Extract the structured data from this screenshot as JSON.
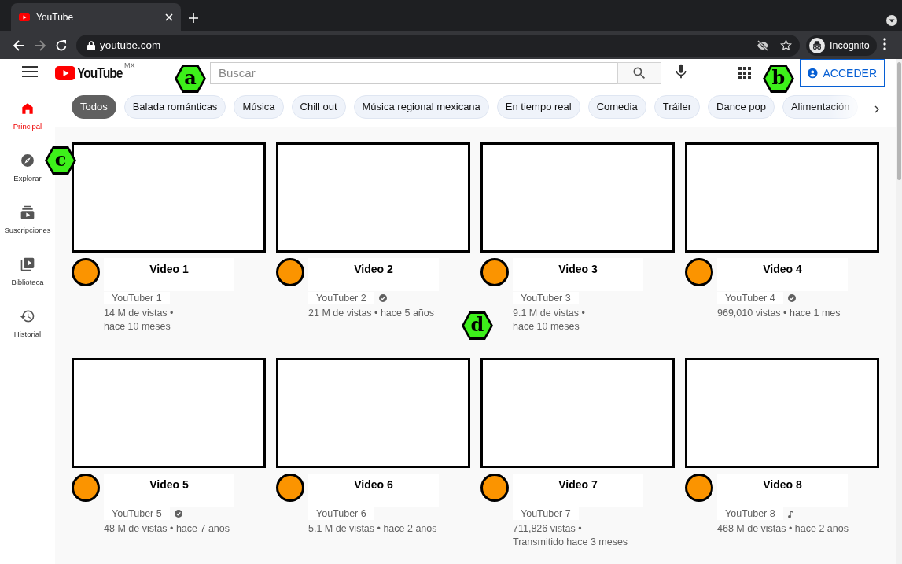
{
  "browser": {
    "tab_title": "YouTube",
    "url": "youtube.com",
    "profile": "Incógnito"
  },
  "header": {
    "logo_text": "YouTube",
    "region": "MX",
    "search": {
      "placeholder": "Buscar"
    },
    "sign_in": "ACCEDER"
  },
  "chips": [
    {
      "label": "Todos",
      "selected": true
    },
    {
      "label": "Balada románticas",
      "selected": false
    },
    {
      "label": "Música",
      "selected": false
    },
    {
      "label": "Chill out",
      "selected": false
    },
    {
      "label": "Música regional mexicana",
      "selected": false
    },
    {
      "label": "En tiempo real",
      "selected": false
    },
    {
      "label": "Comedia",
      "selected": false
    },
    {
      "label": "Tráiler",
      "selected": false
    },
    {
      "label": "Dance pop",
      "selected": false
    },
    {
      "label": "Alimentación",
      "selected": false
    }
  ],
  "sidebar": {
    "items": [
      {
        "label": "Principal",
        "selected": true
      },
      {
        "label": "Explorar",
        "selected": false
      },
      {
        "label": "Suscripciones",
        "selected": false
      },
      {
        "label": "Biblioteca",
        "selected": false
      },
      {
        "label": "Historial",
        "selected": false
      }
    ]
  },
  "videos": [
    {
      "title": "Video 1",
      "channel": "YouTuber 1",
      "kind": "plain",
      "meta": [
        "14 M de vistas •",
        "hace 10 meses"
      ]
    },
    {
      "title": "Video 2",
      "channel": "YouTuber 2",
      "kind": "verified",
      "meta": [
        "21 M de vistas • hace 5 años"
      ]
    },
    {
      "title": "Video 3",
      "channel": "YouTuber 3",
      "kind": "plain",
      "meta": [
        "9.1 M de vistas •",
        "hace 10 meses"
      ]
    },
    {
      "title": "Video 4",
      "channel": "YouTuber 4",
      "kind": "verified",
      "meta": [
        "969,010 vistas • hace 1 mes"
      ]
    },
    {
      "title": "Video 5",
      "channel": "YouTuber 5",
      "kind": "verified",
      "meta": [
        "48 M de vistas • hace 7 años"
      ]
    },
    {
      "title": "Video 6",
      "channel": "YouTuber 6",
      "kind": "plain",
      "meta": [
        "5.1 M de vistas • hace 2 años"
      ]
    },
    {
      "title": "Video 7",
      "channel": "YouTuber 7",
      "kind": "plain",
      "meta": [
        "711,826 vistas •",
        "Transmitido hace 3 meses"
      ]
    },
    {
      "title": "Video 8",
      "channel": "YouTuber 8",
      "kind": "music",
      "meta": [
        "468 M de vistas • hace 2 años"
      ]
    }
  ],
  "markers": [
    {
      "label": "a"
    },
    {
      "label": "b"
    },
    {
      "label": "c"
    },
    {
      "label": "d"
    }
  ]
}
